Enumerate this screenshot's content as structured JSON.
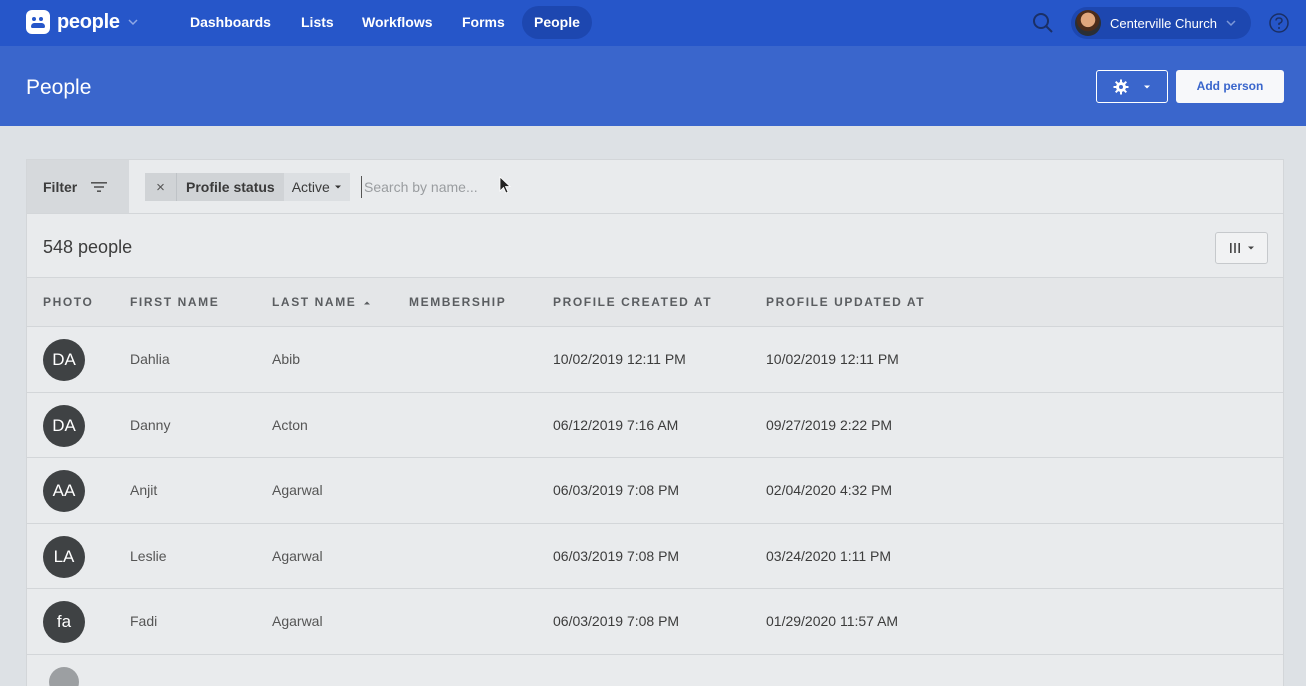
{
  "app": {
    "name": "people",
    "nav": [
      "Dashboards",
      "Lists",
      "Workflows",
      "Forms",
      "People"
    ],
    "active_nav": "People",
    "org_name": "Centerville Church"
  },
  "header": {
    "title": "People",
    "add_button": "Add person"
  },
  "filter": {
    "label": "Filter",
    "chip_label": "Profile status",
    "chip_value": "Active",
    "search_placeholder": "Search by name..."
  },
  "table": {
    "count_label": "548 people",
    "columns": [
      "PHOTO",
      "FIRST NAME",
      "LAST NAME",
      "MEMBERSHIP",
      "PROFILE CREATED AT",
      "PROFILE UPDATED AT"
    ],
    "sort_column": "LAST NAME",
    "rows": [
      {
        "initials": "DA",
        "first": "Dahlia",
        "last": "Abib",
        "membership": "",
        "created": "10/02/2019 12:11 PM",
        "updated": "10/02/2019 12:11 PM"
      },
      {
        "initials": "DA",
        "first": "Danny",
        "last": "Acton",
        "membership": "",
        "created": "06/12/2019 7:16 AM",
        "updated": "09/27/2019 2:22 PM"
      },
      {
        "initials": "AA",
        "first": "Anjit",
        "last": "Agarwal",
        "membership": "",
        "created": "06/03/2019 7:08 PM",
        "updated": "02/04/2020 4:32 PM"
      },
      {
        "initials": "LA",
        "first": "Leslie",
        "last": "Agarwal",
        "membership": "",
        "created": "06/03/2019 7:08 PM",
        "updated": "03/24/2020 1:11 PM"
      },
      {
        "initials": "fa",
        "first": "Fadi",
        "last": "Agarwal",
        "membership": "",
        "created": "06/03/2019 7:08 PM",
        "updated": "01/29/2020 11:57 AM"
      }
    ]
  },
  "colors": {
    "nav_bg": "#2656c9",
    "header_bg": "#3a66cc",
    "avatar_bg": "#3f4244"
  },
  "icons": [
    "people-logo-icon",
    "chevron-down-icon",
    "search-icon",
    "help-icon",
    "gear-icon",
    "filter-icon",
    "close-icon",
    "columns-icon",
    "sort-asc-icon",
    "cursor-icon"
  ]
}
